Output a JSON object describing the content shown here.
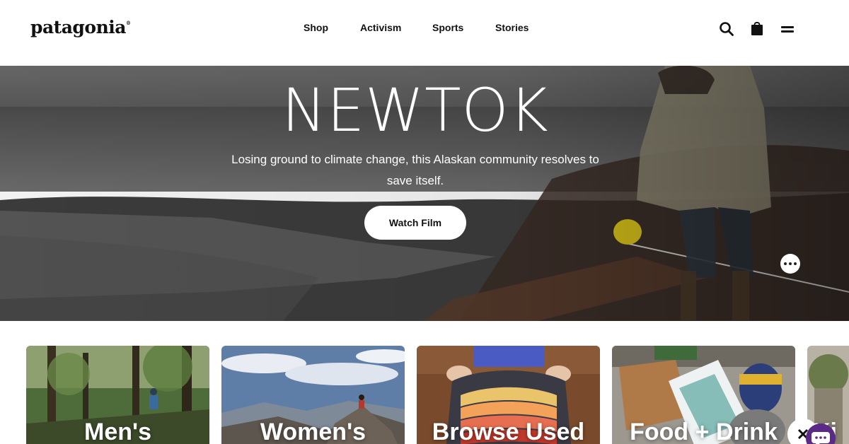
{
  "header": {
    "logo_text": "patagonia",
    "logo_mark": "®",
    "nav": {
      "shop": "Shop",
      "activism": "Activism",
      "sports": "Sports",
      "stories": "Stories"
    },
    "icons": [
      "search-icon",
      "bag-icon",
      "menu-icon"
    ]
  },
  "hero": {
    "title": "NEWTOK",
    "subtitle": "Losing ground to climate change, this Alaskan community resolves to save itself.",
    "cta_label": "Watch Film"
  },
  "categories": {
    "mens": "Men's",
    "womens": "Women's",
    "used": "Browse Used",
    "food": "Food + Drink",
    "kids": "Ki"
  },
  "colors": {
    "text": "#111111",
    "button_bg": "#ffffff",
    "chat_accent": "#5b2a86"
  }
}
